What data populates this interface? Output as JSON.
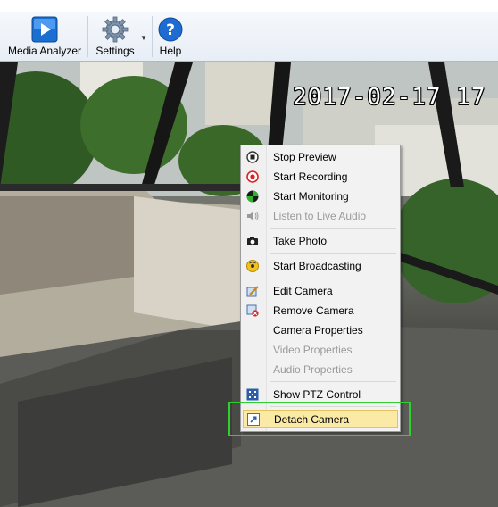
{
  "toolbar": {
    "media_analyzer": "Media Analyzer",
    "settings": "Settings",
    "help": "Help"
  },
  "camera": {
    "timestamp": "2017-02-17 17"
  },
  "menu": {
    "items": [
      {
        "label": "Stop Preview",
        "icon": "stop-icon",
        "enabled": true
      },
      {
        "label": "Start Recording",
        "icon": "record-icon",
        "enabled": true
      },
      {
        "label": "Start Monitoring",
        "icon": "monitor-icon",
        "enabled": true
      },
      {
        "label": "Listen to Live Audio",
        "icon": "speaker-icon",
        "enabled": false
      },
      {
        "label": "Take Photo",
        "icon": "camera-icon",
        "enabled": true
      },
      {
        "label": "Start Broadcasting",
        "icon": "broadcast-icon",
        "enabled": true
      },
      {
        "label": "Edit Camera",
        "icon": "edit-icon",
        "enabled": true
      },
      {
        "label": "Remove Camera",
        "icon": "remove-icon",
        "enabled": true
      },
      {
        "label": "Camera Properties",
        "icon": "none",
        "enabled": true
      },
      {
        "label": "Video Properties",
        "icon": "none",
        "enabled": false
      },
      {
        "label": "Audio Properties",
        "icon": "none",
        "enabled": false
      },
      {
        "label": "Show PTZ Control",
        "icon": "ptz-icon",
        "enabled": true
      },
      {
        "label": "Detach Camera",
        "icon": "detach-icon",
        "enabled": true,
        "highlighted": true
      }
    ]
  },
  "colors": {
    "accent_highlight": "#fbe9a6",
    "annotation_box": "#2fcf2f",
    "toolbar_border": "#e8b24a"
  }
}
